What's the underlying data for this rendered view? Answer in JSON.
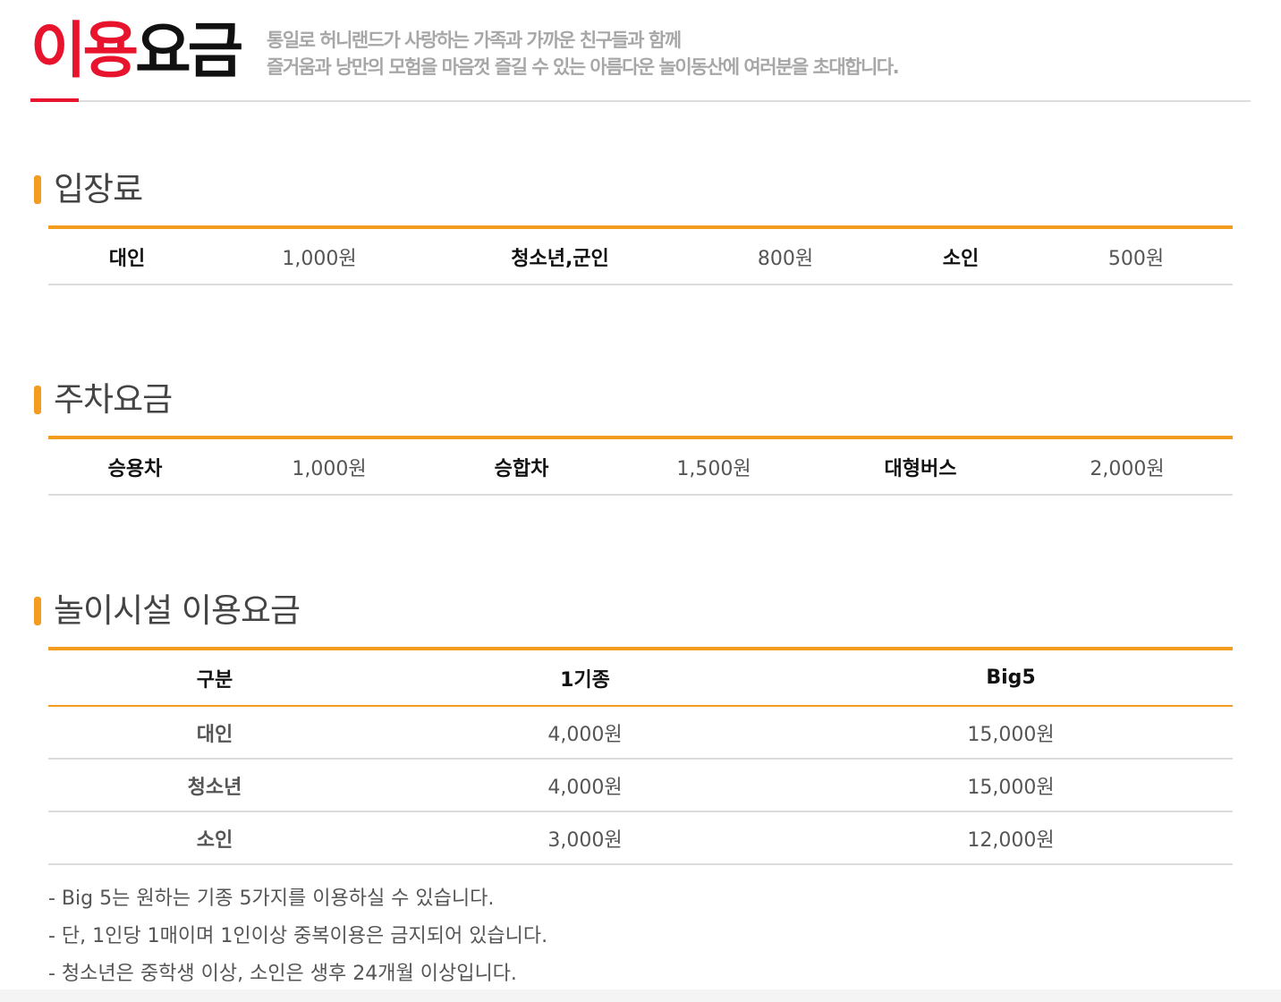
{
  "header": {
    "title_red": "이용",
    "title_black": "요금",
    "intro_line1": "통일로 허니랜드가 사랑하는 가족과 가까운 친구들과 함께",
    "intro_line2": "즐거움과 낭만의 모험을 마음껏 즐길 수 있는 아름다운 놀이동산에 여러분을 초대합니다."
  },
  "admission": {
    "title": "입장료",
    "items": [
      {
        "label": "대인",
        "value": "1,000원"
      },
      {
        "label": "청소년,군인",
        "value": "800원"
      },
      {
        "label": "소인",
        "value": "500원"
      }
    ]
  },
  "parking": {
    "title": "주차요금",
    "items": [
      {
        "label": "승용차",
        "value": "1,000원"
      },
      {
        "label": "승합차",
        "value": "1,500원"
      },
      {
        "label": "대형버스",
        "value": "2,000원"
      }
    ]
  },
  "facility": {
    "title": "놀이시설 이용요금",
    "headers": [
      "구분",
      "1기종",
      "Big5"
    ],
    "rows": [
      {
        "label": "대인",
        "one": "4,000원",
        "big5": "15,000원"
      },
      {
        "label": "청소년",
        "one": "4,000원",
        "big5": "15,000원"
      },
      {
        "label": "소인",
        "one": "3,000원",
        "big5": "12,000원"
      }
    ]
  },
  "notes": [
    "- Big 5는 원하는 기종 5가지를 이용하실 수 있습니다.",
    "- 단, 1인당 1매이며 1인이상 중복이용은 금지되어 있습니다.",
    "- 청소년은 중학생 이상, 소인은 생후 24개월 이상입니다."
  ],
  "colors": {
    "accent_orange": "#f39c1f",
    "title_red": "#e8142d"
  }
}
